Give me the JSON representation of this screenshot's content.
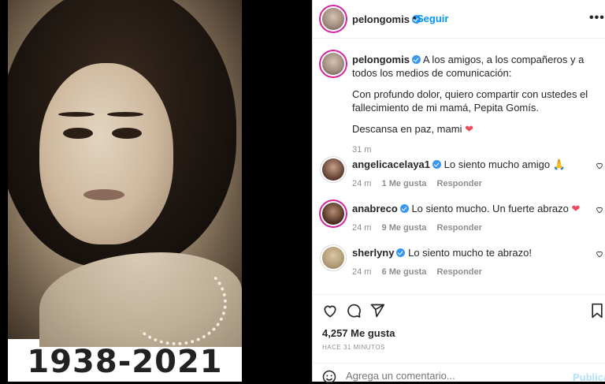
{
  "post": {
    "years": "1938-2021"
  },
  "header": {
    "username": "pelongomis",
    "separator": "•",
    "follow_label": "Seguir",
    "more_label": "•••"
  },
  "caption": {
    "username": "pelongomis",
    "line1": "A los amigos, a los compañeros y a todos los medios de comunicación:",
    "line2": "Con profundo dolor, quiero compartir con ustedes el fallecimiento de mi mamá, Pepita Gomís.",
    "line3": "Descansa en paz, mami",
    "heart": "❤",
    "time": "31 m"
  },
  "comments": [
    {
      "username": "angelicacelaya1",
      "text": "Lo siento mucho amigo",
      "emoji": "🙏",
      "time": "24 m",
      "likes": "1 Me gusta",
      "reply": "Responder"
    },
    {
      "username": "anabreco",
      "text": "Lo siento mucho. Un fuerte abrazo",
      "emoji": "❤",
      "time": "24 m",
      "likes": "9 Me gusta",
      "reply": "Responder"
    },
    {
      "username": "sherlyny",
      "text": "Lo siento mucho te abrazo!",
      "emoji": "",
      "time": "24 m",
      "likes": "6 Me gusta",
      "reply": "Responder"
    }
  ],
  "footer": {
    "likes": "4,257 Me gusta",
    "ago": "HACE 31 MINUTOS",
    "comment_placeholder": "Agrega un comentario...",
    "post_label": "Publicar"
  },
  "colors": {
    "accent": "#0095f6",
    "verified": "#3897f0",
    "heart": "#ed4956"
  }
}
